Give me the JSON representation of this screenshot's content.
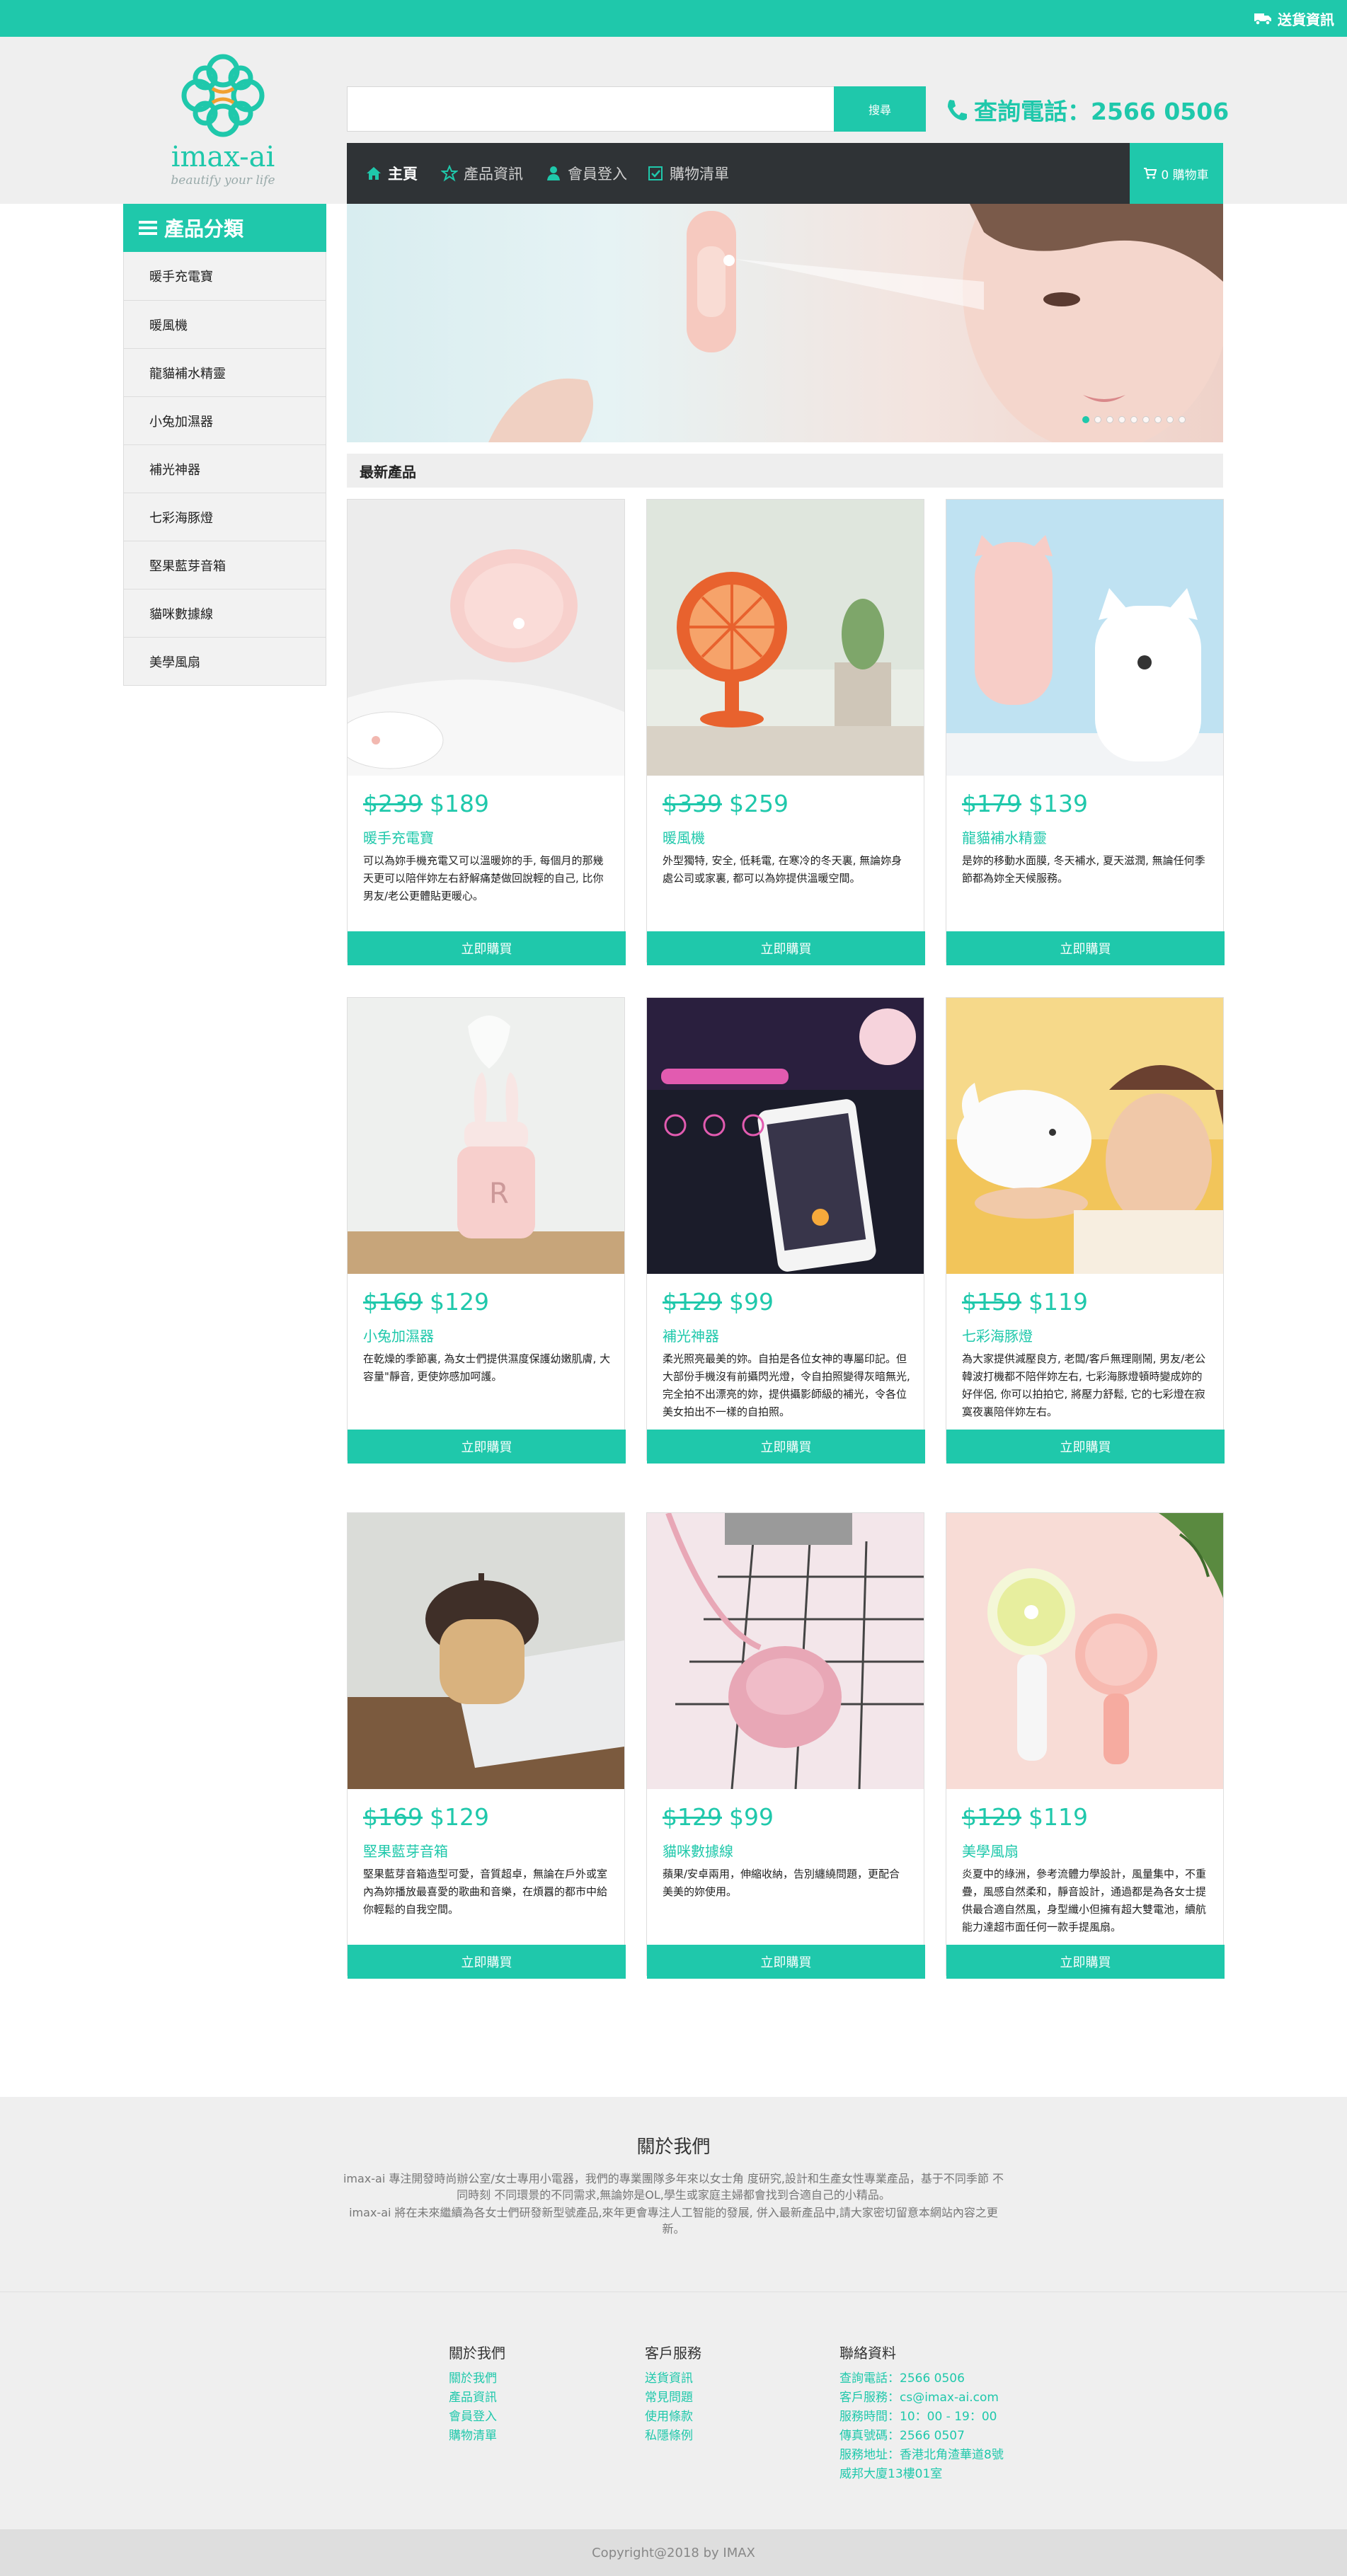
{
  "topbar": {
    "shipping_label": "送貨資訊",
    "icon": "truck-icon"
  },
  "logo": {
    "name": "imax-ai",
    "tagline": "beautify your life"
  },
  "search": {
    "value": "",
    "placeholder": "",
    "button_label": "搜尋"
  },
  "phone": {
    "label": "查詢電話：2566 0506",
    "icon": "phone-icon"
  },
  "nav": {
    "items": [
      {
        "label": "主頁",
        "icon": "home-icon",
        "active": true
      },
      {
        "label": "產品資訊",
        "icon": "star-icon",
        "active": false
      },
      {
        "label": "會員登入",
        "icon": "user-icon",
        "active": false
      },
      {
        "label": "購物清單",
        "icon": "checkbox-icon",
        "active": false
      }
    ],
    "cart_label": "0 購物車"
  },
  "sidebar": {
    "title": "產品分類",
    "items": [
      "暖手充電寶",
      "暖風機",
      "龍貓補水精靈",
      "小兔加濕器",
      "補光神器",
      "七彩海豚燈",
      "堅果藍芽音箱",
      "貓咪數據線",
      "美學風扇"
    ]
  },
  "banner": {
    "slide_count": 9,
    "active_slide": 1
  },
  "latest": {
    "title": "最新產品"
  },
  "products": [
    {
      "old_price": "$239",
      "price": "$189",
      "name": "暖手充電寶",
      "desc": "可以為妳手機充電又可以溫暖妳的手, 每個月的那幾天更可以陪伴妳左右舒解痛楚做回說輕的自己, 比你男友/老公更體貼更暖心。",
      "buy_label": "立即購買"
    },
    {
      "old_price": "$339",
      "price": "$259",
      "name": "暖風機",
      "desc": "外型獨特, 安全, 低耗電, 在寒冷的冬天裏, 無論妳身處公司或家裏, 都可以為妳提供溫暖空間。",
      "buy_label": "立即購買"
    },
    {
      "old_price": "$179",
      "price": "$139",
      "name": "龍貓補水精靈",
      "desc": "是妳的移動水面膜, 冬天補水, 夏天滋潤, 無論任何季節都為妳全天候服務。",
      "buy_label": "立即購買"
    },
    {
      "old_price": "$169",
      "price": "$129",
      "name": "小兔加濕器",
      "desc": "在乾燥的季節裏, 為女士們提供濕度保護幼嫩肌膚, 大容量\"靜音, 更使妳感加呵護。",
      "buy_label": "立即購買"
    },
    {
      "old_price": "$129",
      "price": "$99",
      "name": "補光神器",
      "desc": "柔光照亮最美的妳。自拍是各位女神的專屬印記。但大部份手機沒有前攝閃光燈，令自拍照變得灰暗無光, 完全拍不出漂亮的妳，提供攝影師級的補光，令各位美女拍出不一樣的自拍照。",
      "buy_label": "立即購買"
    },
    {
      "old_price": "$159",
      "price": "$119",
      "name": "七彩海豚燈",
      "desc": "為大家提供減壓良方, 老闆/客戶無理剛鬧, 男友/老公韓波打機都不陪伴妳左右, 七彩海豚燈頓時變成妳的好伴侶, 你可以拍拍它, 將壓力舒鬆, 它的七彩燈在寂寞夜裏陪伴妳左右。",
      "buy_label": "立即購買"
    },
    {
      "old_price": "$169",
      "price": "$129",
      "name": "堅果藍芽音箱",
      "desc": "堅果藍芽音箱造型可愛，音質超卓，無論在戶外或室內為妳播放最喜愛的歌曲和音樂，在煩囂的都市中給你輕鬆的自我空間。",
      "buy_label": "立即購買"
    },
    {
      "old_price": "$129",
      "price": "$99",
      "name": "貓咪數據線",
      "desc": "蘋果/安卓兩用，伸縮收納，告別纏繞問題，更配合美美的妳使用。",
      "buy_label": "立即購買"
    },
    {
      "old_price": "$129",
      "price": "$119",
      "name": "美學風扇",
      "desc": "炎夏中的綠洲，參考流體力學設計，風量集中，不重疊，風感自然柔和，靜音設計，通過都是為各女士提供最合適自然風，身型纖小但擁有超大雙電池，續航能力達超市面任何一款手提風扇。",
      "buy_label": "立即購買"
    }
  ],
  "about": {
    "title": "關於我們",
    "p1": "imax-ai 專注開發時尚辦公室/女士專用小電器，我們的專業團隊多年來以女士角 度研究,設計和生產女性專業產品，基于不同季節 不同時刻 不同環景的不同需求,無論妳是OL,學生或家庭主婦都會找到合適自己的小精品。",
    "p2": "imax-ai 將在未來繼續為各女士們研發新型號產品,來年更會專注人工智能的發展, 併入最新產品中,請大家密切留意本網站內容之更新。"
  },
  "footer": {
    "col1": {
      "title": "關於我們",
      "links": [
        "關於我們",
        "產品資訊",
        "會員登入",
        "購物清單"
      ]
    },
    "col2": {
      "title": "客戶服務",
      "links": [
        "送貨資訊",
        "常見問題",
        "使用條款",
        "私隱條例"
      ]
    },
    "col3": {
      "title": "聯絡資料",
      "lines": [
        "查詢電話：2566 0506",
        "客戶服務：cs@imax-ai.com",
        "服務時間：10：00 - 19：00",
        "傳真號碼：2566 0507",
        "服務地址：香港北角渣華道8號",
        "威邦大廈13樓01室"
      ]
    }
  },
  "copyright": "Copyright@2018 by IMAX",
  "colors": {
    "accent": "#1fc8ab",
    "nav_bg": "#2f3336",
    "band_bg": "#efefef"
  }
}
